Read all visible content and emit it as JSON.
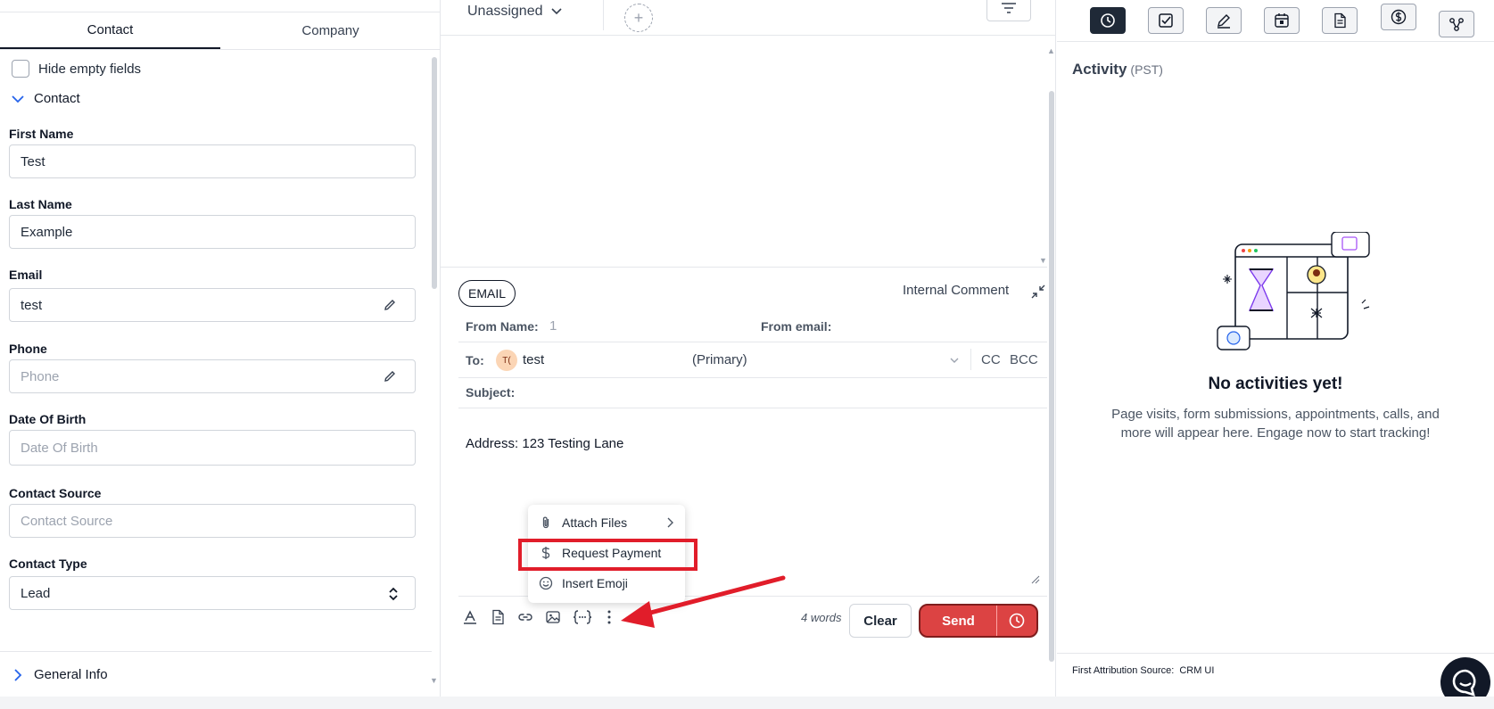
{
  "left_panel": {
    "tabs": [
      {
        "label": "Contact",
        "active": true
      },
      {
        "label": "Company",
        "active": false
      }
    ],
    "hide_empty_label": "Hide empty fields",
    "section_contact": "Contact",
    "fields": {
      "first_name": {
        "label": "First Name",
        "value": "Test"
      },
      "last_name": {
        "label": "Last Name",
        "value": "Example"
      },
      "email": {
        "label": "Email",
        "value": "test"
      },
      "phone": {
        "label": "Phone",
        "placeholder": "Phone"
      },
      "dob": {
        "label": "Date Of Birth",
        "placeholder": "Date Of Birth"
      },
      "contact_source": {
        "label": "Contact Source",
        "placeholder": "Contact Source"
      },
      "contact_type": {
        "label": "Contact Type",
        "value": "Lead"
      }
    },
    "section_general": "General Info"
  },
  "middle_panel": {
    "assign_label": "Unassigned",
    "composer": {
      "channel": "EMAIL",
      "internal_comment": "Internal Comment",
      "from_name_label": "From Name:",
      "from_name_value": "1",
      "from_email_label": "From email:",
      "to_label": "To:",
      "to_avatar": "T(",
      "to_value": "test",
      "to_tag": "(Primary)",
      "cc": "CC",
      "bcc": "BCC",
      "subject_label": "Subject:",
      "body": "Address: 123 Testing Lane",
      "word_count": "4 words",
      "clear": "Clear",
      "send": "Send"
    },
    "menu": {
      "items": [
        {
          "label": "Attach Files",
          "icon": "paperclip-icon"
        },
        {
          "label": "Request Payment",
          "icon": "dollar-icon"
        },
        {
          "label": "Insert Emoji",
          "icon": "smiley-icon"
        }
      ]
    }
  },
  "right_panel": {
    "icons": [
      "clock-icon",
      "checkbox-icon",
      "pen-icon",
      "calendar-icon",
      "document-icon",
      "dollar-circle-icon",
      "workflow-icon"
    ],
    "activity_title": "Activity",
    "activity_tz": "(PST)",
    "empty_title": "No activities yet!",
    "empty_text": "Page visits, form submissions, appointments, calls, and more will appear here. Engage now to start tracking!",
    "attribution_label": "First Attribution Source:",
    "attribution_value": "CRM UI"
  },
  "colors": {
    "accent_red": "#dc4343",
    "highlight_red": "#e11d2a",
    "dark": "#1f2937",
    "link_blue": "#2563eb"
  }
}
